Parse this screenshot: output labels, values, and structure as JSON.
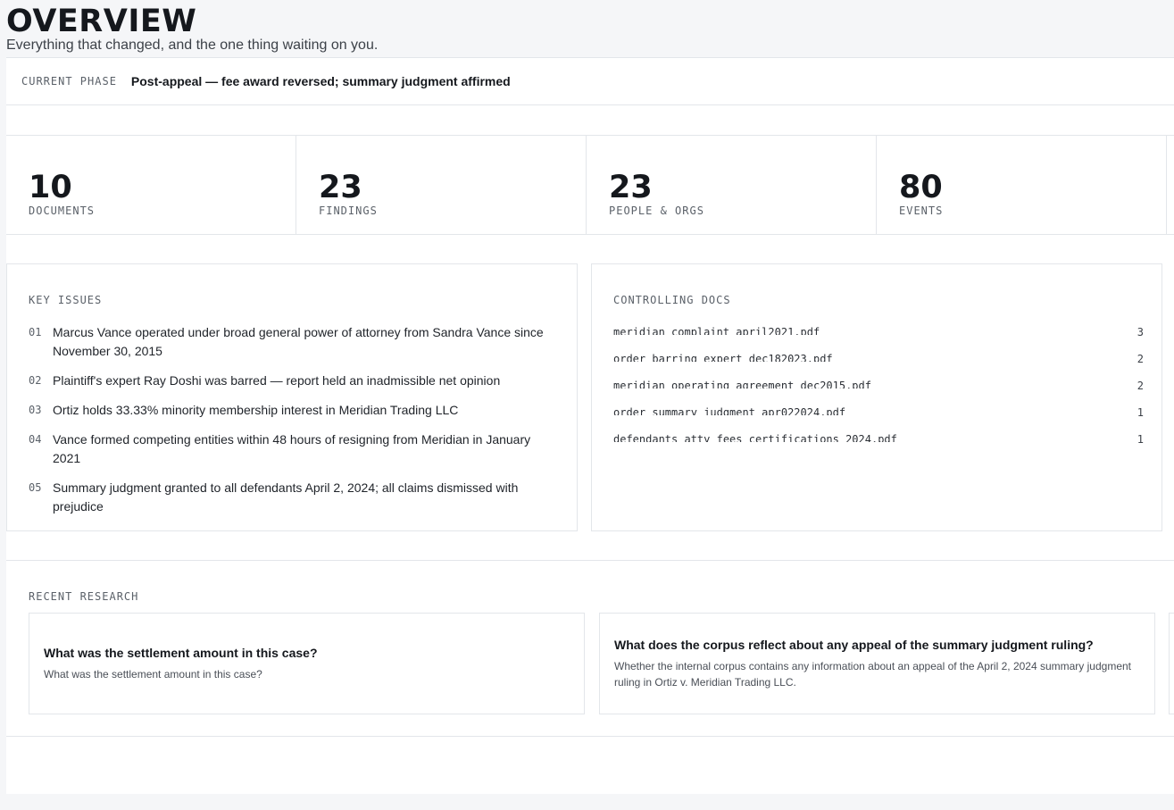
{
  "header": {
    "title": "OVERVIEW",
    "subtitle": "Everything that changed, and the one thing waiting on you."
  },
  "phase": {
    "label": "CURRENT PHASE",
    "value": "Post-appeal — fee award reversed; summary judgment affirmed"
  },
  "stats": [
    {
      "number": "10",
      "label": "DOCUMENTS"
    },
    {
      "number": "23",
      "label": "FINDINGS"
    },
    {
      "number": "23",
      "label": "PEOPLE & ORGS"
    },
    {
      "number": "80",
      "label": "EVENTS"
    }
  ],
  "key_issues": {
    "heading": "KEY ISSUES",
    "items": [
      {
        "num": "01",
        "text": "Marcus Vance operated under broad general power of attorney from Sandra Vance since November 30, 2015"
      },
      {
        "num": "02",
        "text": "Plaintiff's expert Ray Doshi was barred — report held an inadmissible net opinion"
      },
      {
        "num": "03",
        "text": "Ortiz holds 33.33% minority membership interest in Meridian Trading LLC"
      },
      {
        "num": "04",
        "text": "Vance formed competing entities within 48 hours of resigning from Meridian in January 2021"
      },
      {
        "num": "05",
        "text": "Summary judgment granted to all defendants April 2, 2024; all claims dismissed with prejudice"
      }
    ]
  },
  "controlling_docs": {
    "heading": "CONTROLLING DOCS",
    "items": [
      {
        "name": "meridian_complaint_april2021.pdf",
        "count": "3"
      },
      {
        "name": "order_barring_expert_dec182023.pdf",
        "count": "2"
      },
      {
        "name": "meridian_operating_agreement_dec2015.pdf",
        "count": "2"
      },
      {
        "name": "order_summary_judgment_apr022024.pdf",
        "count": "1"
      },
      {
        "name": "defendants_atty_fees_certifications_2024.pdf",
        "count": "1"
      }
    ]
  },
  "recent_research": {
    "heading": "RECENT RESEARCH",
    "cards": [
      {
        "title": "What was the settlement amount in this case?",
        "description": "What was the settlement amount in this case?"
      },
      {
        "title": "What does the corpus reflect about any appeal of the summary judgment ruling?",
        "description": "Whether the internal corpus contains any information about an appeal of the April 2, 2024 summary judgment ruling in Ortiz v. Meridian Trading LLC."
      }
    ]
  }
}
